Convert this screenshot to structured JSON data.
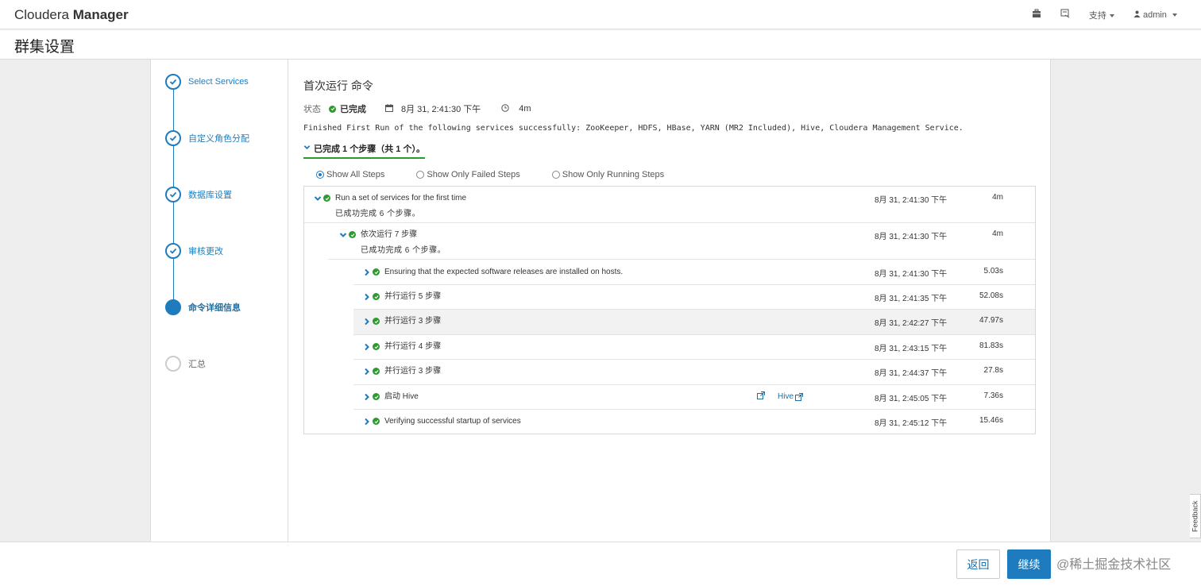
{
  "app": {
    "brand_light": "Cloudera ",
    "brand_bold": "Manager"
  },
  "topnav": {
    "support": "支持",
    "user": "admin"
  },
  "page": {
    "title": "群集设置"
  },
  "wizard": {
    "steps": [
      {
        "label": "Select Services",
        "state": "done"
      },
      {
        "label": "自定义角色分配",
        "state": "done"
      },
      {
        "label": "数据库设置",
        "state": "done"
      },
      {
        "label": "审核更改",
        "state": "done"
      },
      {
        "label": "命令详细信息",
        "state": "active"
      },
      {
        "label": "汇总",
        "state": "todo"
      }
    ]
  },
  "command": {
    "title": "首次运行 命令",
    "status_label": "状态",
    "status_value": "已完成",
    "started": "8月 31, 2:41:30 下午",
    "duration": "4m",
    "message": "Finished First Run of the following services successfully: ZooKeeper, HDFS, HBase, YARN (MR2 Included), Hive, Cloudera Management Service.",
    "summary": "已完成 1 个步骤（共 1 个）。"
  },
  "filters": {
    "all": "Show All Steps",
    "failed": "Show Only Failed Steps",
    "running": "Show Only Running Steps"
  },
  "steps": {
    "root": {
      "name": "Run a set of services for the first time",
      "sub": "已成功完成 6 个步骤。",
      "time": "8月 31, 2:41:30 下午",
      "duration": "4m"
    },
    "group": {
      "name": "依次运行 7 步骤",
      "sub": "已成功完成 6 个步骤。",
      "time": "8月 31, 2:41:30 下午",
      "duration": "4m"
    },
    "items": [
      {
        "name": "Ensuring that the expected software releases are installed on hosts.",
        "time": "8月 31, 2:41:30 下午",
        "duration": "5.03s"
      },
      {
        "name": "并行运行 5 步骤",
        "time": "8月 31, 2:41:35 下午",
        "duration": "52.08s"
      },
      {
        "name": "并行运行 3 步骤",
        "time": "8月 31, 2:42:27 下午",
        "duration": "47.97s"
      },
      {
        "name": "并行运行 4 步骤",
        "time": "8月 31, 2:43:15 下午",
        "duration": "81.83s"
      },
      {
        "name": "并行运行 3 步骤",
        "time": "8月 31, 2:44:37 下午",
        "duration": "27.8s"
      },
      {
        "name": "启动 Hive",
        "time": "8月 31, 2:45:05 下午",
        "duration": "7.36s",
        "link": "Hive"
      },
      {
        "name": "Verifying successful startup of services",
        "time": "8月 31, 2:45:12 下午",
        "duration": "15.46s"
      }
    ]
  },
  "footer": {
    "back": "返回",
    "next": "继续",
    "watermark": "@稀土掘金技术社区"
  },
  "feedback": "Feedback",
  "colors": {
    "accent": "#1e7bbd",
    "success": "#2d9a2d"
  }
}
